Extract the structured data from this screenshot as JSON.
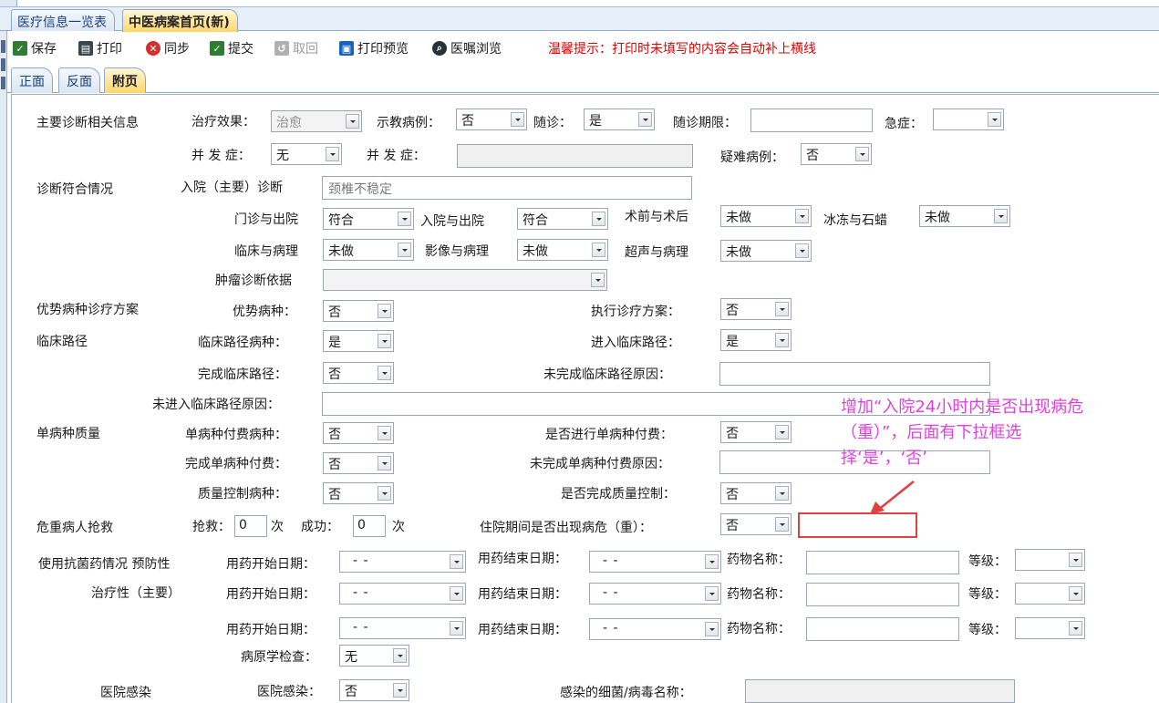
{
  "tabs": [
    "医疗信息一览表",
    "中医病案首页(新)"
  ],
  "toolbar": {
    "save": "保存",
    "print": "打印",
    "sync": "同步",
    "submit": "提交",
    "withdraw": "取回",
    "preview": "打印预览",
    "order": "医嘱浏览",
    "hint": "温馨提示：打印时未填写的内容会自动补上横线"
  },
  "subtabs": [
    "正面",
    "反面",
    "附页"
  ],
  "form": {
    "main_diag_info": "主要诊断相关信息",
    "treat_effect_lbl": "治疗效果：",
    "treat_effect": "治愈",
    "teaching_lbl": "示教病例：",
    "teaching": "否",
    "followup_lbl": "随诊：",
    "followup": "是",
    "followup_period_lbl": "随诊期限：",
    "followup_period": "",
    "urgent_lbl": "急症：",
    "urgent": "",
    "complication_lbl": "并 发 症：",
    "complication": "无",
    "complication2_lbl": "并 发 症：",
    "difficult_lbl": "疑难病例：",
    "difficult": "否",
    "diag_match": "诊断符合情况",
    "admit_diag_lbl": "入院（主要）诊断",
    "admit_diag": "颈椎不稳定",
    "op_out_lbl": "门诊与出院",
    "op_out": "符合",
    "in_out_lbl": "入院与出院",
    "in_out": "符合",
    "pre_post_lbl": "术前与术后",
    "pre_post": "未做",
    "frozen_lbl": "冰冻与石蜡",
    "frozen": "未做",
    "clin_path_lbl": "临床与病理",
    "clin_path": "未做",
    "img_path_lbl": "影像与病理",
    "img_path": "未做",
    "us_path_lbl": "超声与病理",
    "us_path": "未做",
    "tumor_basis_lbl": "肿瘤诊断依据",
    "tumor_basis": "",
    "adv_scheme": "优势病种诊疗方案",
    "adv_lbl": "优势病种：",
    "adv": "否",
    "exec_scheme_lbl": "执行诊疗方案：",
    "exec_scheme": "否",
    "clinical_path": "临床路径",
    "cp_disease_lbl": "临床路径病种：",
    "cp_disease": "是",
    "enter_cp_lbl": "进入临床路径：",
    "enter_cp": "是",
    "complete_cp_lbl": "完成临床路径：",
    "complete_cp": "否",
    "incomplete_cp_reason_lbl": "未完成临床路径原因：",
    "not_enter_reason_lbl": "未进入临床路径原因：",
    "single_quality": "单病种质量",
    "sp_pay_lbl": "单病种付费病种：",
    "sp_pay": "否",
    "do_sp_pay_lbl": "是否进行单病种付费：",
    "do_sp_pay": "否",
    "complete_sp_pay_lbl": "完成单病种付费：",
    "complete_sp_pay": "否",
    "incomplete_sp_reason_lbl": "未完成单病种付费原因：",
    "qc_lbl": "质量控制病种：",
    "qc": "否",
    "complete_qc_lbl": "是否完成质量控制：",
    "complete_qc": "否",
    "critical": "危重病人抢救",
    "rescue_lbl": "抢救：",
    "rescue": "0",
    "unit1": "次",
    "success_lbl": "成功：",
    "success": "0",
    "unit2": "次",
    "critical_in_hosp_lbl": "住院期间是否出现病危（重）：",
    "critical_in_hosp": "否",
    "antibiotic": "使用抗菌药情况 预防性",
    "treatment_main": "治疗性（主要）",
    "start_lbl": "用药开始日期：",
    "end_lbl": "用药结束日期：",
    "drug_lbl": "药物名称：",
    "grade_lbl": "等级：",
    "date_blank": "-   -",
    "pathology_lbl": "病原学检查：",
    "pathology": "无",
    "infection": "医院感染",
    "infection_lbl": "医院感染：",
    "infection_v": "否",
    "bacteria_lbl": "感染的细菌/病毒名称："
  },
  "annotation": {
    "line1": "增加“入院24小时内是否出现病危",
    "line2": "（重）”，后面有下拉框选",
    "line3": "择‘是’，‘否’"
  }
}
